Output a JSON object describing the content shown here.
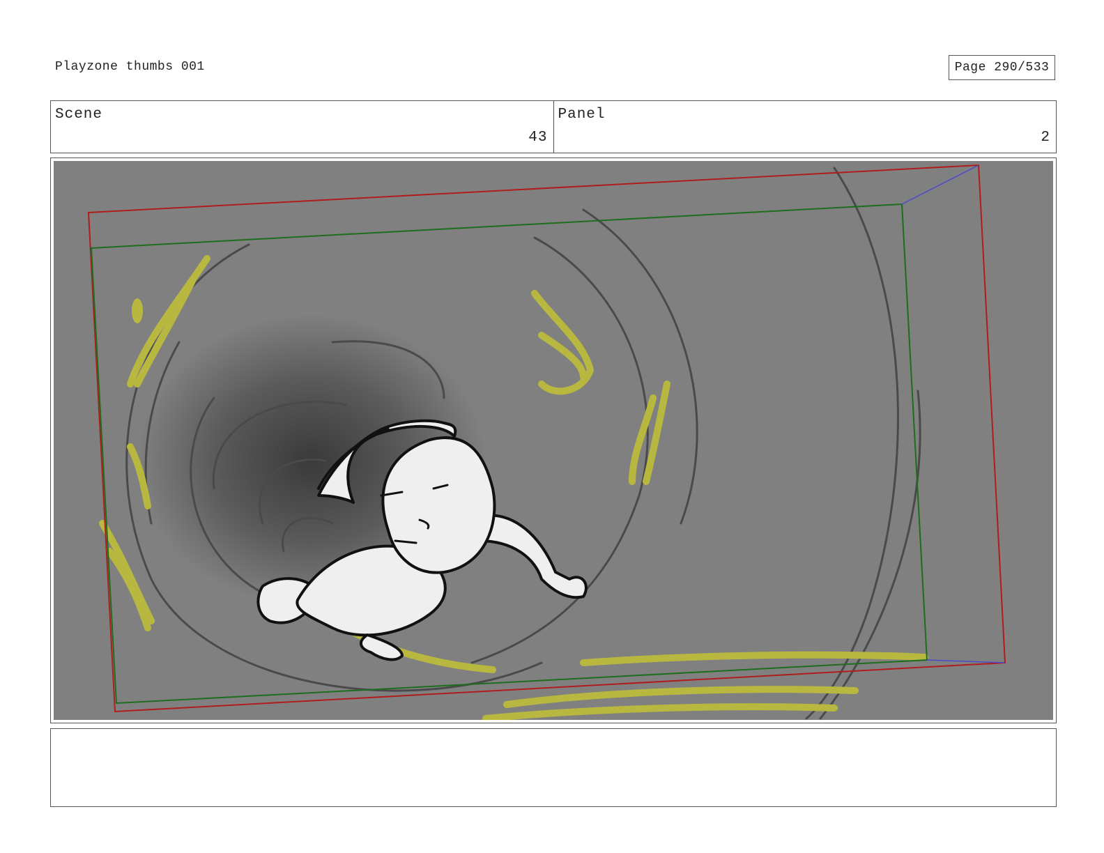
{
  "document": {
    "title": "Playzone thumbs 001",
    "page": "Page 290/533"
  },
  "header": {
    "scene": {
      "label": "Scene",
      "value": "43"
    },
    "panel": {
      "label": "Panel",
      "value": "2"
    }
  },
  "artwork": {
    "description_icon": "storyboard-sketch-image",
    "colors": {
      "background": "#808080",
      "sketch": "#4a4a4a",
      "highlight": "#b8b840",
      "safe_frame": "#b01c1c",
      "action_frame": "#1c6e1c",
      "camera_move": "#4a4acc",
      "character_fill": "#efefef"
    }
  },
  "notes": {
    "text": ""
  }
}
